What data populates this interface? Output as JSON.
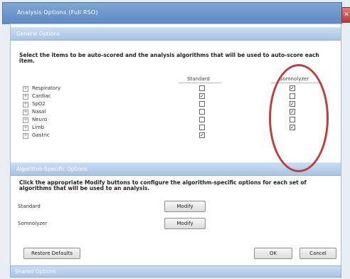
{
  "window": {
    "title": "Analysis Options (Full RSO)",
    "close_icon": "close-icon"
  },
  "general": {
    "header": "General Options",
    "instructions": "Select the items to be auto-scored and the analysis algorithms that will be used to auto-score each item.",
    "columns": {
      "standard": "Standard",
      "somnolyzer": "Somnolyzer"
    },
    "items": [
      {
        "label": "Respiratory",
        "standard": false,
        "somnolyzer": true
      },
      {
        "label": "Cardiac",
        "standard": true,
        "somnolyzer": false
      },
      {
        "label": "SpO2",
        "standard": false,
        "somnolyzer": true
      },
      {
        "label": "Nasal",
        "standard": false,
        "somnolyzer": true
      },
      {
        "label": "Neuro",
        "standard": false,
        "somnolyzer": false
      },
      {
        "label": "Limb",
        "standard": false,
        "somnolyzer": true
      },
      {
        "label": "Gastric",
        "standard": true,
        "somnolyzer": false
      }
    ]
  },
  "algorithm": {
    "header": "Algorithm-Specific Options",
    "instructions": "Click the appropriate Modify buttons to configure the algorithm-specific options for each set of algorithms that will be used to an analysis.",
    "rows": [
      {
        "label": "Standard",
        "button": "Modify"
      },
      {
        "label": "Somnolyzer",
        "button": "Modify"
      }
    ]
  },
  "footer": {
    "restore_defaults": "Restore Defaults",
    "ok": "OK",
    "cancel": "Cancel"
  },
  "bottom_bar": {
    "label": "Shared Options"
  },
  "colors": {
    "titlebar": "#5d89c2",
    "section_header": "#a9c4e4",
    "annotation": "#b8433f"
  }
}
